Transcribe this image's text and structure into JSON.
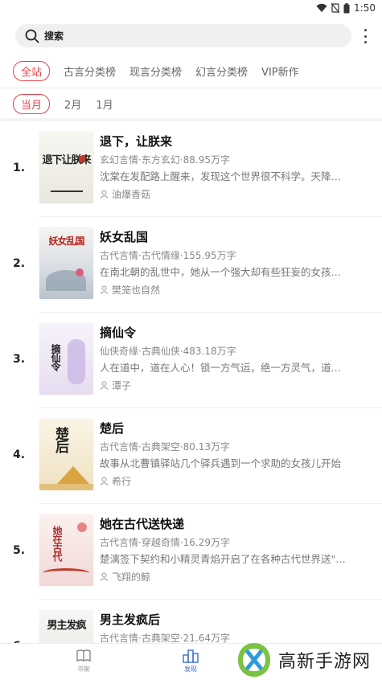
{
  "status_bar": {
    "time": "1:50"
  },
  "search": {
    "label": "搜索"
  },
  "category_tabs": [
    "全站",
    "古言分类榜",
    "现言分类榜",
    "幻言分类榜",
    "VIP新作"
  ],
  "period_tabs": [
    "当月",
    "2月",
    "1月"
  ],
  "books": [
    {
      "rank": "1.",
      "title": "退下，让朕来",
      "tags": "玄幻言情·东方玄幻·88.95万字",
      "desc": "沈棠在发配路上醒来，发现这个世界很不科学。天降…",
      "author": "油爆香菇",
      "cover_text": "退下让朕来",
      "cover_bg": "#f3f3ef"
    },
    {
      "rank": "2.",
      "title": "妖女乱国",
      "tags": "古代言情·古代情缘·155.95万字",
      "desc": "在南北朝的乱世中，她从一个强大却有些狂妄的女孩…",
      "author": "樊笼也自然",
      "cover_text": "妖女乱国",
      "cover_bg": "#eef0f2"
    },
    {
      "rank": "3.",
      "title": "摘仙令",
      "tags": "仙侠奇缘·古典仙侠·483.18万字",
      "desc": "人在道中，道在人心！锁一方气运，绝一方灵气，道…",
      "author": "潭子",
      "cover_text": "摘仙令",
      "cover_bg": "#f1eef7"
    },
    {
      "rank": "4.",
      "title": "楚后",
      "tags": "古代言情·古典架空·80.13万字",
      "desc": "故事从北曹镇驿站几个驿兵遇到一个求助的女孩儿开始",
      "author": "希行",
      "cover_text": "楚后",
      "cover_bg": "#f6efe0"
    },
    {
      "rank": "5.",
      "title": "她在古代送快递",
      "tags": "古代言情·穿越奇情·16.29万字",
      "desc": "楚漓签下契约和小精灵青焰开启了在各种古代世界送\"…",
      "author": "飞翔的鲸",
      "cover_text": "她在古代",
      "cover_bg": "#f8ecec"
    },
    {
      "rank": "6.",
      "title": "男主发疯后",
      "tags": "古代言情·古典架空·21.64万字",
      "desc": "",
      "author": "",
      "cover_text": "男主发疯",
      "cover_bg": "#f2f2f2"
    }
  ],
  "bottom_nav": [
    {
      "label": "书架"
    },
    {
      "label": "发现"
    }
  ],
  "watermark": {
    "text": "高新手游网"
  },
  "colors": {
    "accent": "#e0464a",
    "nav_active": "#3b6bd6"
  }
}
